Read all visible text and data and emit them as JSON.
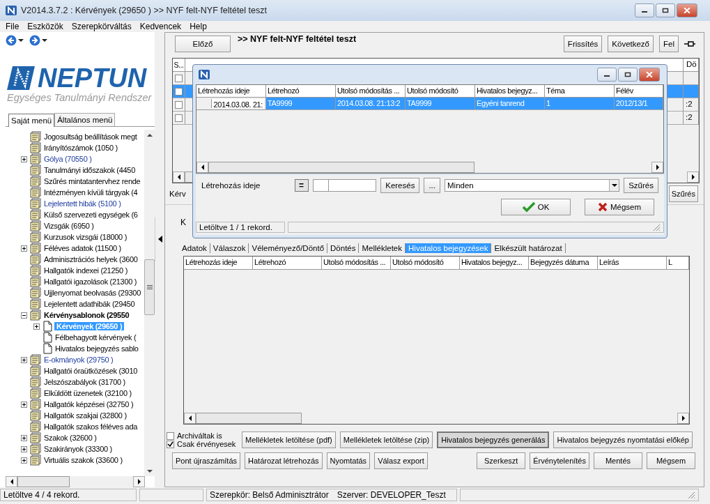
{
  "window": {
    "title": "V2014.3.7.2 : Kérvények (29650  ) >> NYF felt-NYF feltétel teszt"
  },
  "menu": [
    "File",
    "Eszközök",
    "Szerepkörváltás",
    "Kedvencek",
    "Help"
  ],
  "logo": {
    "name": "NEPTUN",
    "tagline": "Egységes Tanulmányi Rendszer"
  },
  "menu_tabs": [
    {
      "label": "Saját menü",
      "selected": true
    },
    {
      "label": "Általános menü",
      "selected": false
    }
  ],
  "tree": [
    {
      "label": "Jogosultság beállítások megt",
      "kind": "group",
      "selected": false,
      "linked": false
    },
    {
      "label": "Irányítószámok (1050  )",
      "kind": "group",
      "selected": false,
      "linked": false
    },
    {
      "label": "Gólya (70550  )",
      "kind": "group",
      "selected": false,
      "linked": true,
      "expanded": false
    },
    {
      "label": "Tanulmányi időszakok (4450",
      "kind": "group",
      "selected": false,
      "linked": false
    },
    {
      "label": "Szűrés mintatantervhez rende",
      "kind": "group",
      "selected": false,
      "linked": false
    },
    {
      "label": "Intézményen kívüli tárgyak (4",
      "kind": "group",
      "selected": false,
      "linked": false
    },
    {
      "label": "Lejelentett hibák (5100  )",
      "kind": "group",
      "selected": false,
      "linked": true
    },
    {
      "label": "Külső szervezeti egységek (6",
      "kind": "group",
      "selected": false,
      "linked": false
    },
    {
      "label": "Vizsgák (6950  )",
      "kind": "group",
      "selected": false,
      "linked": false
    },
    {
      "label": "Kurzusok vizsgái (18000  )",
      "kind": "group",
      "selected": false,
      "linked": false
    },
    {
      "label": "Féléves adatok (11500  )",
      "kind": "group",
      "selected": false,
      "linked": false,
      "expanded": false
    },
    {
      "label": "Adminisztrációs helyek (3600",
      "kind": "group",
      "selected": false,
      "linked": false
    },
    {
      "label": "Hallgatók indexei (21250  )",
      "kind": "group",
      "selected": false,
      "linked": false
    },
    {
      "label": "Hallgatói igazolások (21300  )",
      "kind": "group",
      "selected": false,
      "linked": false
    },
    {
      "label": "Ujjlenyomat beolvasás (29300",
      "kind": "group",
      "selected": false,
      "linked": false
    },
    {
      "label": "Lejelentett adathibák (29450",
      "kind": "group",
      "selected": false,
      "linked": false
    },
    {
      "label": "Kérvénysablonok (29550",
      "kind": "group",
      "selected": false,
      "linked": false,
      "expanded": true,
      "children": [
        {
          "label": "Kérvények (29650  )",
          "kind": "page",
          "selected": true,
          "linked": false,
          "expanded": false
        },
        {
          "label": "Félbehagyott kérvények (",
          "kind": "page",
          "selected": false,
          "linked": false
        },
        {
          "label": "Hivatalos bejegyzés sablo",
          "kind": "page",
          "selected": false,
          "linked": false
        }
      ]
    },
    {
      "label": "E-okmányok (29750  )",
      "kind": "group",
      "selected": false,
      "linked": true,
      "expanded": false
    },
    {
      "label": "Hallgatói óraütközések (3010",
      "kind": "group",
      "selected": false,
      "linked": false
    },
    {
      "label": "Jelszószabályok (31700  )",
      "kind": "group",
      "selected": false,
      "linked": false
    },
    {
      "label": "Elküldött üzenetek (32100  )",
      "kind": "group",
      "selected": false,
      "linked": false
    },
    {
      "label": "Hallgatók képzései (32750  )",
      "kind": "group",
      "selected": false,
      "linked": false,
      "expanded": false
    },
    {
      "label": "Hallgatók szakjai (32800  )",
      "kind": "group",
      "selected": false,
      "linked": false
    },
    {
      "label": "Hallgatók szakos féléves ada",
      "kind": "group",
      "selected": false,
      "linked": false
    },
    {
      "label": "Szakok (32600  )",
      "kind": "group",
      "selected": false,
      "linked": false,
      "expanded": false
    },
    {
      "label": "Szakirányok (33300  )",
      "kind": "group",
      "selected": false,
      "linked": false,
      "expanded": false
    },
    {
      "label": "Virtuális szakok (33600  )",
      "kind": "group",
      "selected": false,
      "linked": false,
      "expanded": false
    }
  ],
  "header": {
    "prev_button": "Előző",
    "title": ">> NYF felt-NYF feltétel teszt",
    "buttons": [
      "Frissítés",
      "Következő",
      "Fel"
    ]
  },
  "main_grid": {
    "columns": [
      "S...",
      "Dö"
    ],
    "rows": [
      {
        "selected": false,
        "checked": false
      },
      {
        "selected": true,
        "checked": false
      },
      {
        "selected": false,
        "checked": false,
        "last": ":2"
      },
      {
        "selected": false,
        "checked": false,
        "last": ":2"
      }
    ]
  },
  "filter": {
    "label": "Kérv",
    "button": "Szűrés"
  },
  "lower_tab": "K",
  "detail_tabs": [
    {
      "label": "Adatok",
      "selected": false
    },
    {
      "label": "Válaszok",
      "selected": false
    },
    {
      "label": "Véleményező/Döntő",
      "selected": false
    },
    {
      "label": "Döntés",
      "selected": false
    },
    {
      "label": "Mellékletek",
      "selected": false
    },
    {
      "label": "Hivatalos bejegyzések",
      "selected": true
    },
    {
      "label": "Elkészült határozat",
      "selected": false
    }
  ],
  "detail_grid": {
    "columns": [
      "Létrehozás ideje",
      "Létrehozó",
      "Utolsó módosítás ...",
      "Utolsó módosító",
      "Hivatalos bejegyz...",
      "Bejegyzés dátuma",
      "Leírás",
      "L"
    ]
  },
  "options": [
    {
      "label": "Archiváltak is",
      "checked": false
    },
    {
      "label": "Csak érvényesek",
      "checked": true
    }
  ],
  "action_buttons": [
    {
      "label": "Mellékletek letöltése (pdf)",
      "focused": false
    },
    {
      "label": "Mellékletek letöltése (zip)",
      "focused": false
    },
    {
      "label": "Hivatalos bejegyzés generálás",
      "focused": true
    },
    {
      "label": "Hivatalos bejegyzés nyomtatási előkép",
      "focused": false
    }
  ],
  "left_buttons": [
    "Pont újraszámítás",
    "Határozat létrehozás",
    "Nyomtatás",
    "Válasz export"
  ],
  "right_buttons": [
    "Szerkeszt",
    "Érvénytelenítés",
    "Mentés",
    "Mégsem"
  ],
  "status_bar": {
    "records": "Letöltve 4 / 4 rekord.",
    "role": "Szerepkör: Belső Adminisztrátor",
    "server": "Szerver: DEVELOPER_Teszt"
  },
  "dialog": {
    "columns": [
      "Létrehozás ideje",
      "Létrehozó",
      "Utolsó módosítás ...",
      "Utolsó módosító",
      "Hivatalos bejegyz...",
      "Téma",
      "Félév"
    ],
    "rows": [
      {
        "selected": true,
        "cells": [
          "2014.03.08. 21:",
          "TA9999",
          "2014.03.08. 21:13:2",
          "TA9999",
          "Egyéni tanrend",
          "1",
          "2012/13/1"
        ]
      }
    ],
    "filter": {
      "label": "Létrehozás ideje",
      "operator": "=",
      "search_button": "Keresés",
      "more_button": "...",
      "select_value": "Minden",
      "filter_button": "Szűrés"
    },
    "ok_button": "OK",
    "cancel_button": "Mégsem",
    "status": "Letöltve 1 / 1 rekord."
  }
}
